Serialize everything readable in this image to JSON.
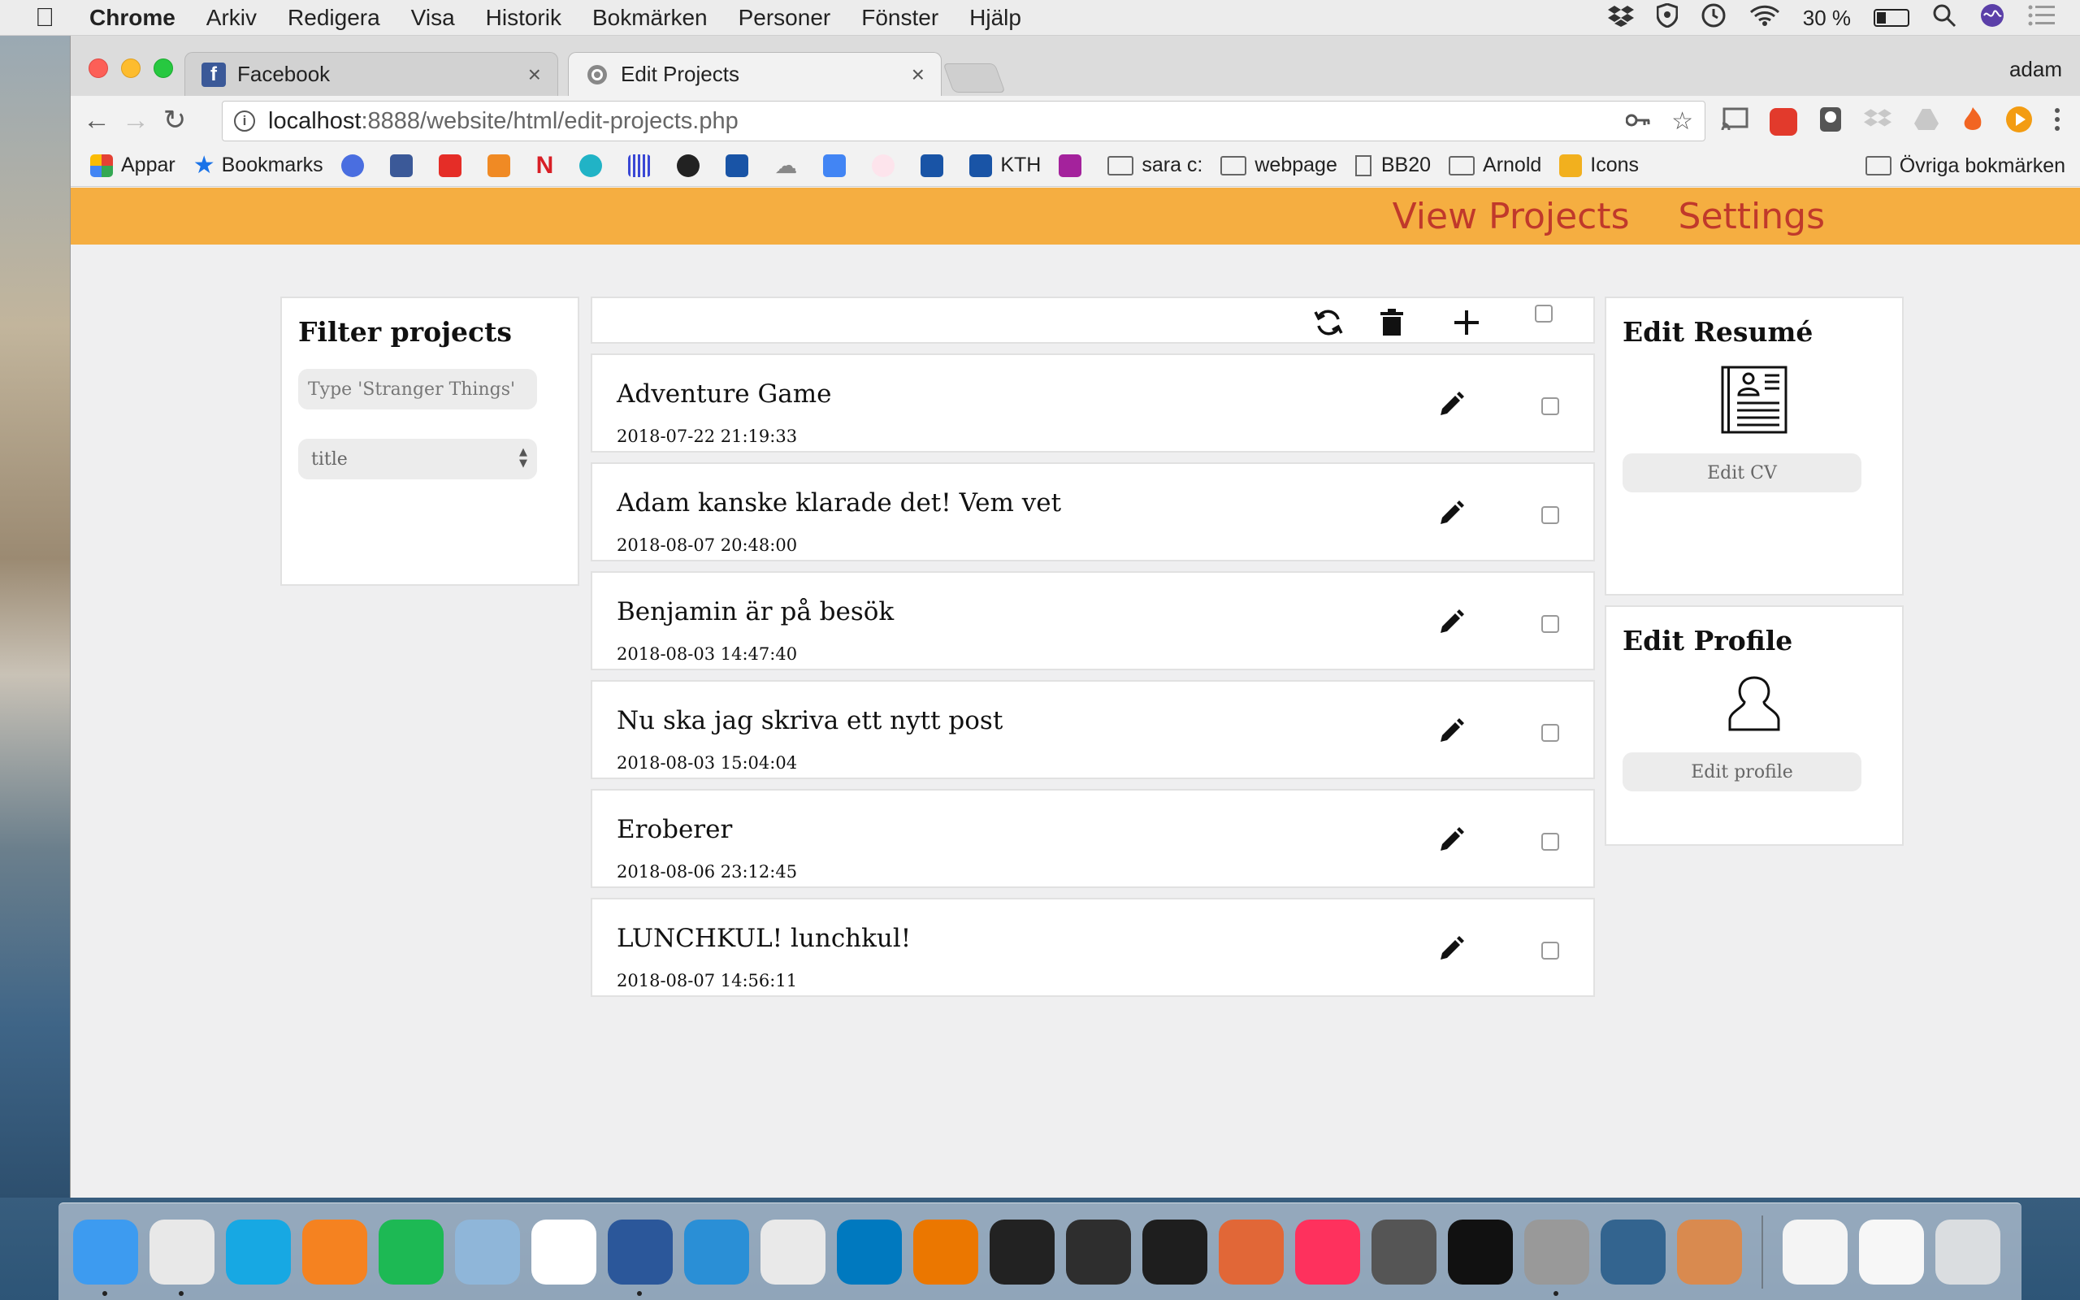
{
  "menubar": {
    "app_name": "Chrome",
    "menus": [
      "Arkiv",
      "Redigera",
      "Visa",
      "Historik",
      "Bokmärken",
      "Personer",
      "Fönster",
      "Hjälp"
    ],
    "battery_percent": "30 %",
    "battery_level": 0.3
  },
  "browser": {
    "tabs": [
      {
        "title": "Facebook",
        "favicon": "facebook-icon",
        "color": "#3b5998"
      },
      {
        "title": "Edit Projects",
        "favicon": "globe-icon",
        "color": "#8a8a8a"
      }
    ],
    "profile": "adam",
    "url_host": "localhost",
    "url_rest": ":8888/website/html/edit-projects.php",
    "bookmarks": [
      {
        "label": "Appar",
        "icon": "apps-grid-icon",
        "color": "#e44134"
      },
      {
        "label": "Bookmarks",
        "icon": "star-icon",
        "color": "#1a73e8"
      },
      {
        "label": "",
        "icon": "messages-icon",
        "color": "#4a6ee0"
      },
      {
        "label": "",
        "icon": "facebook-icon",
        "color": "#3b5998"
      },
      {
        "label": "",
        "icon": "youtube-icon",
        "color": "#e52d27"
      },
      {
        "label": "",
        "icon": "bulb-icon",
        "color": "#f08a24"
      },
      {
        "label": "",
        "icon": "netflix-icon",
        "color": "#d81f26"
      },
      {
        "label": "",
        "icon": "globe-icon",
        "color": "#21b3c6"
      },
      {
        "label": "",
        "icon": "waveform-icon",
        "color": "#3a47d5"
      },
      {
        "label": "",
        "icon": "github-icon",
        "color": "#222222"
      },
      {
        "label": "",
        "icon": "kth-icon",
        "color": "#1954a6"
      },
      {
        "label": "",
        "icon": "cloud-icon",
        "color": "#888888"
      },
      {
        "label": "",
        "icon": "calendar-icon",
        "color": "#4285f4"
      },
      {
        "label": "",
        "icon": "dots-icon",
        "color": "#f06292"
      },
      {
        "label": "",
        "icon": "kth-icon",
        "color": "#1954a6"
      },
      {
        "label": "KTH",
        "icon": "kth-icon",
        "color": "#1954a6"
      },
      {
        "label": "",
        "icon": "e-icon",
        "color": "#a4229c"
      },
      {
        "label": "sara c:",
        "icon": "folder-icon",
        "color": "#666666"
      },
      {
        "label": "webpage",
        "icon": "folder-icon",
        "color": "#666666"
      },
      {
        "label": "BB20",
        "icon": "page-icon",
        "color": "#666666"
      },
      {
        "label": "Arnold",
        "icon": "folder-icon",
        "color": "#666666"
      },
      {
        "label": "Icons",
        "icon": "icons-icon",
        "color": "#f2b01e"
      }
    ],
    "other_bookmarks": "Övriga bokmärken"
  },
  "site": {
    "nav": {
      "view_projects": "View Projects",
      "settings": "Settings"
    },
    "accent": "#f5ae41",
    "link_color": "#c0392b"
  },
  "filter": {
    "heading": "Filter projects",
    "search_placeholder": "Type 'Stranger Things'",
    "sort_selected": "title"
  },
  "projects": [
    {
      "title": "Adventure Game",
      "date": "2018-07-22 21:19:33"
    },
    {
      "title": "Adam kanske klarade det! Vem vet",
      "date": "2018-08-07 20:48:00"
    },
    {
      "title": "Benjamin är på besök",
      "date": "2018-08-03 14:47:40"
    },
    {
      "title": "Nu ska jag skriva ett nytt post",
      "date": "2018-08-03 15:04:04"
    },
    {
      "title": "Eroberer",
      "date": "2018-08-06 23:12:45"
    },
    {
      "title": "LUNCHKUL! lunchkul!",
      "date": "2018-08-07 14:56:11"
    }
  ],
  "resume": {
    "heading": "Edit Resumé",
    "button": "Edit CV"
  },
  "profile": {
    "heading": "Edit Profile",
    "button": "Edit profile"
  },
  "dock": {
    "apps": [
      {
        "name": "finder-icon",
        "color": "#3d9bf0",
        "running": true
      },
      {
        "name": "chrome-icon",
        "color": "#e8e8e8",
        "running": true
      },
      {
        "name": "skype-icon",
        "color": "#17a8e3",
        "running": false
      },
      {
        "name": "vlc-icon",
        "color": "#f58220",
        "running": false
      },
      {
        "name": "spotify-icon",
        "color": "#1db954",
        "running": false
      },
      {
        "name": "preview-icon",
        "color": "#8fb6d9",
        "running": false
      },
      {
        "name": "calendar-icon",
        "color": "#ffffff",
        "running": false
      },
      {
        "name": "word-icon",
        "color": "#2b579a",
        "running": true
      },
      {
        "name": "brackets-icon",
        "color": "#2a8fd6",
        "running": false
      },
      {
        "name": "slack-icon",
        "color": "#e9e9e9",
        "running": false
      },
      {
        "name": "trello-icon",
        "color": "#0079bf",
        "running": false
      },
      {
        "name": "blender-icon",
        "color": "#eb7700",
        "running": false
      },
      {
        "name": "unity-icon",
        "color": "#222222",
        "running": false
      },
      {
        "name": "davinci-icon",
        "color": "#2e2e2e",
        "running": false
      },
      {
        "name": "terminal-icon",
        "color": "#1e1e1e",
        "running": false
      },
      {
        "name": "matlab-icon",
        "color": "#e16737",
        "running": false
      },
      {
        "name": "intellij-icon",
        "color": "#fe315d",
        "running": false
      },
      {
        "name": "colorpicker-icon",
        "color": "#555555",
        "running": false
      },
      {
        "name": "p3-icon",
        "color": "#111111",
        "running": false
      },
      {
        "name": "mamp-icon",
        "color": "#999999",
        "running": true
      },
      {
        "name": "mysql-icon",
        "color": "#33648f",
        "running": false
      },
      {
        "name": "mamp-pro-icon",
        "color": "#d98a4f",
        "running": false
      },
      {
        "name": "textedit-icon",
        "color": "#f4f4f4",
        "running": false
      },
      {
        "name": "document-icon",
        "color": "#f7f7f7",
        "running": false
      },
      {
        "name": "trash-icon",
        "color": "#dadde0",
        "running": false
      }
    ]
  }
}
